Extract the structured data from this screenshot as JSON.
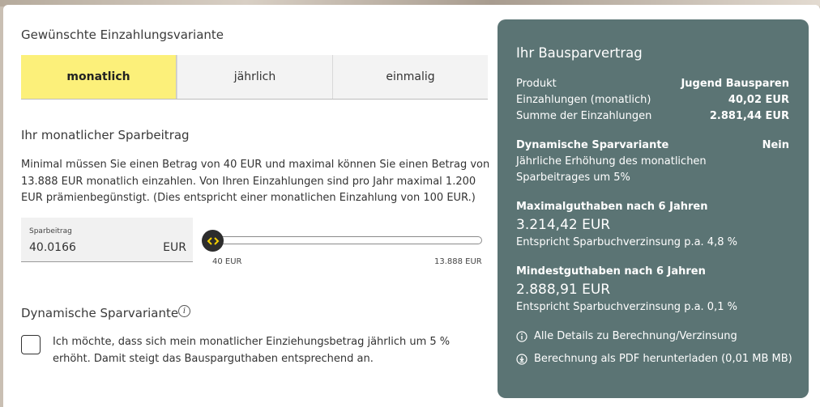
{
  "variant": {
    "title": "Gewünschte Einzahlungsvariante",
    "tabs": [
      {
        "label": "monatlich",
        "active": true
      },
      {
        "label": "jährlich",
        "active": false
      },
      {
        "label": "einmalig",
        "active": false
      }
    ]
  },
  "savings": {
    "title": "Ihr monatlicher Sparbeitrag",
    "description": "Minimal müssen Sie einen Betrag von 40 EUR und maximal können Sie einen Betrag von 13.888 EUR monatlich einzahlen. Von Ihren Einzahlungen sind pro Jahr maximal 1.200 EUR prämienbegünstigt. (Dies entspricht einer monatlichen Einzahlung von 100 EUR.)",
    "amount_label": "Sparbeitrag",
    "amount_value": "40.0166",
    "amount_unit": "EUR",
    "slider_min_label": "40 EUR",
    "slider_max_label": "13.888 EUR",
    "slider_fraction": 0.0
  },
  "dynamic": {
    "title": "Dynamische Sparvariante",
    "info_icon": "i",
    "checkbox_checked": false,
    "checkbox_text": "Ich möchte, dass sich mein monatlicher Einziehungsbetrag jährlich um 5 % erhöht. Damit steigt das Bausparguthaben entsprechend an."
  },
  "contract": {
    "title": "Ihr Bausparvertrag",
    "rows": [
      {
        "label": "Produkt",
        "value": "Jugend Bausparen"
      },
      {
        "label": "Einzahlungen (monatlich)",
        "value": "40,02 EUR"
      },
      {
        "label": "Summe der Einzahlungen",
        "value": "2.881,44 EUR"
      }
    ],
    "dynamic_label": "Dynamische Sparvariante",
    "dynamic_value": "Nein",
    "dynamic_desc": "Jährliche Erhöhung des monatlichen Sparbeitrages um 5%",
    "max_label": "Maximalguthaben nach 6 Jahren",
    "max_value": "3.214,42 EUR",
    "max_note": "Entspricht Sparbuchverzinsung p.a. 4,8 %",
    "min_label": "Mindestguthaben nach 6 Jahren",
    "min_value": "2.888,91 EUR",
    "min_note": "Entspricht Sparbuchverzinsung p.a. 0,1 %",
    "details_link": "Alle Details zu Berechnung/Verzinsung",
    "pdf_link": "Berechnung als PDF herunterladen (0,01 MB MB)"
  },
  "colors": {
    "active_tab": "#fcf07a",
    "panel_bg": "#5b7474",
    "slider_knob": "#2d2d2d",
    "knob_arrows": "#f5d000"
  },
  "icons": {
    "info": "info-icon",
    "details": "info-circle-icon",
    "download": "download-icon",
    "slider": "slider-arrows-icon"
  }
}
